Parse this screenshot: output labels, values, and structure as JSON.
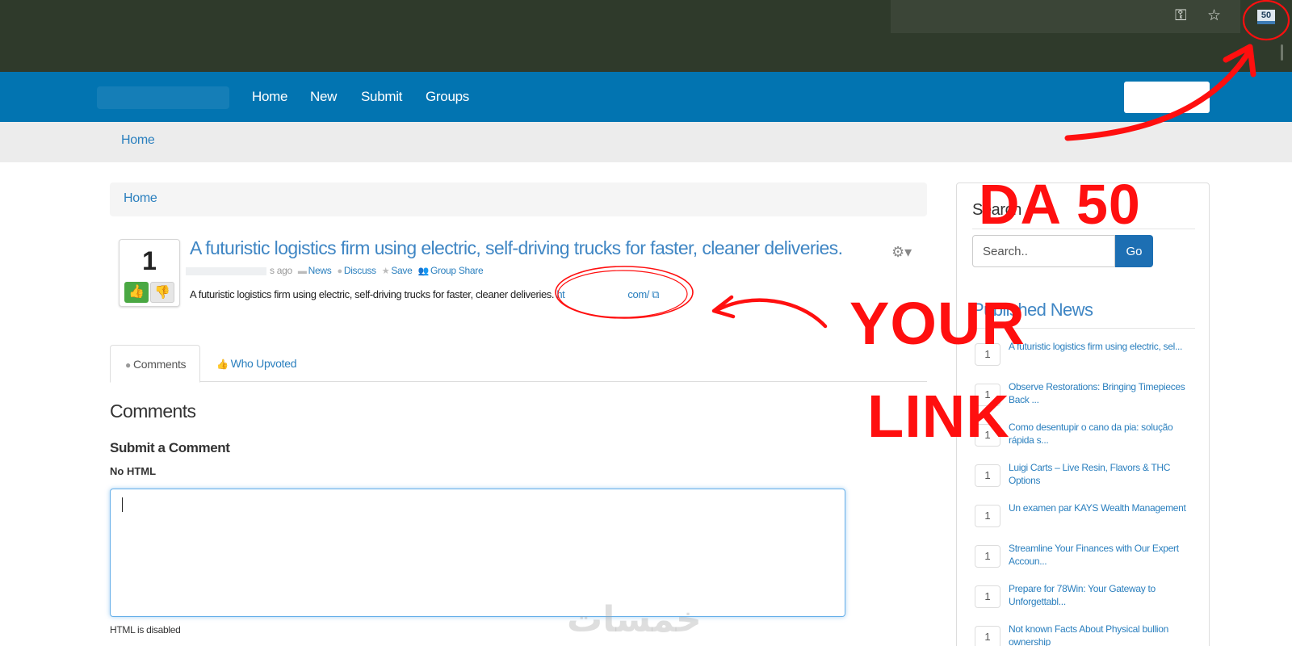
{
  "browser": {
    "extension_badge": "50",
    "key_icon": "key-icon",
    "star_icon": "star-icon"
  },
  "nav": {
    "items": [
      "Home",
      "New",
      "Submit",
      "Groups"
    ]
  },
  "subbar": {
    "home": "Home"
  },
  "breadcrumb": {
    "home": "Home"
  },
  "story": {
    "votes": "1",
    "title": "A futuristic logistics firm using electric, self-driving trucks for faster, cleaner deliveries.",
    "meta_time": "s ago",
    "meta_category": "News",
    "meta_discuss": "Discuss",
    "meta_save": "Save",
    "meta_group_share": "Group Share",
    "description": "A futuristic logistics firm using electric, self-driving trucks for faster, cleaner deliveries.",
    "link_start": "ht",
    "link_end": "com/"
  },
  "tabs": {
    "comments": "Comments",
    "who_upvoted": "Who Upvoted"
  },
  "comments": {
    "heading": "Comments",
    "submit_heading": "Submit a Comment",
    "no_html": "No HTML",
    "html_disabled": "HTML is disabled"
  },
  "sidebar": {
    "search_heading": "Search",
    "search_placeholder": "Search..",
    "go_label": "Go",
    "published_heading": "Published News",
    "news": [
      {
        "count": "1",
        "title": "A futuristic logistics firm using electric, sel..."
      },
      {
        "count": "1",
        "title": "Observe Restorations: Bringing Timepieces Back ..."
      },
      {
        "count": "1",
        "title": "Como desentupir o cano da pia: solução rápida s..."
      },
      {
        "count": "1",
        "title": "Luigi Carts – Live Resin, Flavors & THC Options"
      },
      {
        "count": "1",
        "title": "Un examen par KAYS Wealth Management"
      },
      {
        "count": "1",
        "title": "Streamline Your Finances with Our Expert Accoun..."
      },
      {
        "count": "1",
        "title": "Prepare for 78Win: Your Gateway to Unforgettabl..."
      },
      {
        "count": "1",
        "title": "Not known Facts About Physical bullion ownership"
      }
    ]
  },
  "annotation": {
    "da": "DA 50",
    "your": "YOUR",
    "link": "LINK",
    "color": "#ff0f0f"
  },
  "watermark": "خمسات"
}
